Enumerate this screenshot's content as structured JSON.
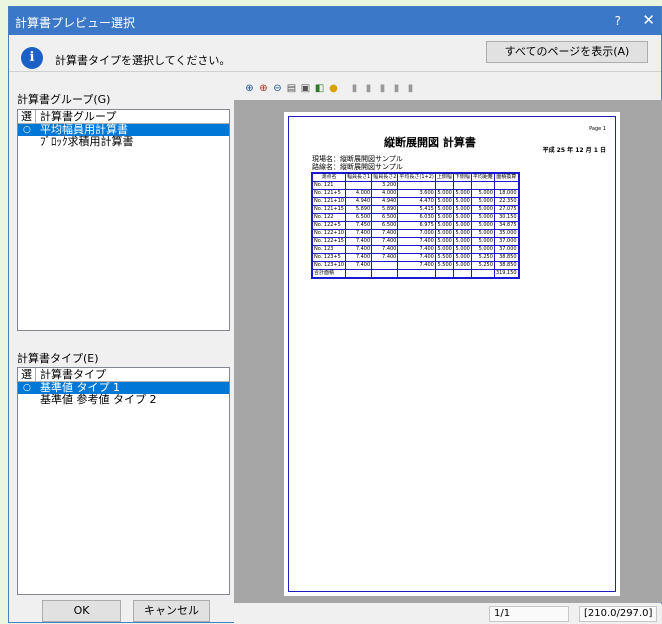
{
  "window": {
    "title": "計算書プレビュー選択",
    "help": "?",
    "close": "✕"
  },
  "message": "計算書タイプを選択してください。",
  "show_all_button": "すべてのページを表示(A)",
  "group_label": "計算書グループ(G)",
  "group_list": {
    "col1": "選",
    "col2": "計算書グループ",
    "items": [
      {
        "mark": "○",
        "label": "平均幅員用計算書",
        "selected": true
      },
      {
        "mark": "",
        "label": "ﾌﾞﾛｯｸ求積用計算書",
        "selected": false
      }
    ]
  },
  "type_label": "計算書タイプ(E)",
  "type_list": {
    "col1": "選",
    "col2": "計算書タイプ",
    "items": [
      {
        "mark": "○",
        "label": "基準値 タイプ 1",
        "selected": true
      },
      {
        "mark": "",
        "label": "基準値 参考値 タイプ 2",
        "selected": false
      }
    ]
  },
  "ok_button": "OK",
  "cancel_button": "キャンセル",
  "status": {
    "page": "1/1",
    "size": "[210.0/297.0]"
  },
  "paper": {
    "page_label": "Page  1",
    "title": "縦断展開図 計算書",
    "date": "平成 25 年 12 月 1 日",
    "line1": "現場名：縦断展開図サンプル",
    "line2": "路線名：縦断展開図サンプル",
    "headers": [
      "測点名",
      "幅員長さ1",
      "幅員長さ2",
      "平均長さ(1+2)",
      "上側幅",
      "下側幅",
      "平均距離",
      "面積換算"
    ],
    "rows": [
      [
        "No. 121",
        "",
        "3.200",
        "",
        "",
        "",
        "",
        ""
      ],
      [
        "No. 121+5",
        "4.000",
        "4.000",
        "3.600",
        "5.000",
        "5.000",
        "5.000",
        "18.000"
      ],
      [
        "No. 121+10",
        "4.940",
        "4.940",
        "4.470",
        "5.000",
        "5.000",
        "5.000",
        "22.350"
      ],
      [
        "No. 121+15",
        "5.890",
        "5.890",
        "5.415",
        "5.000",
        "5.000",
        "5.000",
        "27.075"
      ],
      [
        "No. 122",
        "6.500",
        "6.500",
        "6.030",
        "5.000",
        "5.000",
        "5.000",
        "30.150"
      ],
      [
        "No. 122+5",
        "7.450",
        "6.500",
        "6.975",
        "5.000",
        "5.000",
        "5.000",
        "34.875"
      ],
      [
        "No. 122+10",
        "7.400",
        "7.400",
        "7.000",
        "5.000",
        "5.000",
        "5.000",
        "35.000"
      ],
      [
        "No. 122+15",
        "7.400",
        "7.400",
        "7.400",
        "5.000",
        "5.000",
        "5.000",
        "37.000"
      ],
      [
        "No. 123",
        "7.400",
        "7.400",
        "7.400",
        "5.000",
        "5.000",
        "5.000",
        "37.000"
      ],
      [
        "No. 123+5",
        "7.400",
        "7.400",
        "7.400",
        "5.500",
        "5.000",
        "5.250",
        "38.850"
      ],
      [
        "No. 123+10",
        "7.400",
        "",
        "7.400",
        "5.500",
        "5.000",
        "5.250",
        "38.850"
      ],
      [
        "合計面積",
        "",
        "",
        "",
        "",
        "",
        "",
        "319.150"
      ]
    ]
  }
}
